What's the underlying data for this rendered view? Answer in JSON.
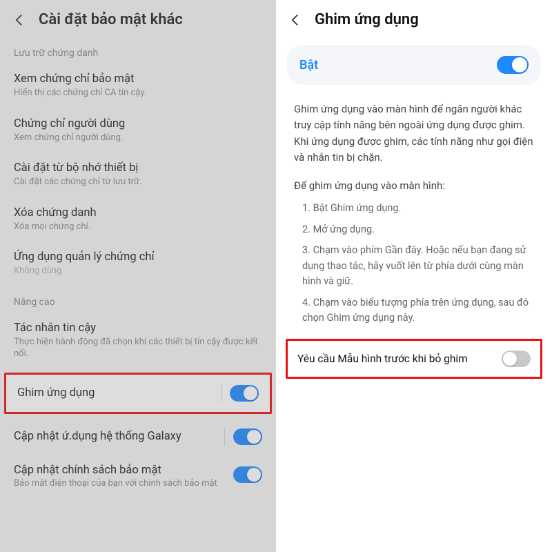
{
  "left": {
    "title": "Cài đặt bảo mật khác",
    "section1": "Lưu trữ chứng danh",
    "items": [
      {
        "title": "Xem chứng chỉ bảo mật",
        "sub": "Hiển thị các chứng chỉ CA tin cậy."
      },
      {
        "title": "Chứng chỉ người dùng",
        "sub": "Xem chứng chỉ người dùng."
      },
      {
        "title": "Cài đặt từ bộ nhớ thiết bị",
        "sub": "Cài đặt các chứng chỉ từ lưu trữ."
      },
      {
        "title": "Xóa chứng danh",
        "sub": "Xóa mọi chứng chỉ."
      },
      {
        "title": "Ứng dụng quản lý chứng chỉ",
        "sub": "Không dùng"
      }
    ],
    "section2": "Nâng cao",
    "adv": [
      {
        "title": "Tác nhân tin cậy",
        "sub": "Thực hiện hành động đã chọn khi các thiết bị tin cậy được kết nối."
      }
    ],
    "pin_row": {
      "title": "Ghim ứng dụng",
      "on": true
    },
    "galaxy_row": {
      "title": "Cập nhật ứ.dụng hệ thống Galaxy",
      "on": true
    },
    "policy_row": {
      "title": "Cập nhật chính sách bảo mật",
      "sub": "Bảo mật điện thoại của bạn với chính sách bảo mật",
      "on": true
    }
  },
  "right": {
    "title": "Ghim ứng dụng",
    "master": {
      "label": "Bật",
      "on": true
    },
    "desc1": "Ghim ứng dụng vào màn hình để ngăn người khác truy cập tính năng bên ngoài ứng dụng được ghim. Khi ứng dụng được ghim, các tính năng như gọi điện và nhắn tin bị chặn.",
    "steps_intro": "Để ghim ứng dụng vào màn hình:",
    "steps": [
      "1. Bật Ghim ứng dụng.",
      "2. Mở ứng dụng.",
      "3. Chạm vào phím Gần đây. Hoặc nếu bạn đang sử dụng thao tác, hãy vuốt lên từ phía dưới cùng màn hình và giữ.",
      "4. Chạm vào biểu tượng phía trên ứng dụng, sau đó chọn Ghim ứng dụng này."
    ],
    "require": {
      "title": "Yêu cầu Mẫu hình trước khi bỏ ghim",
      "on": false
    }
  }
}
